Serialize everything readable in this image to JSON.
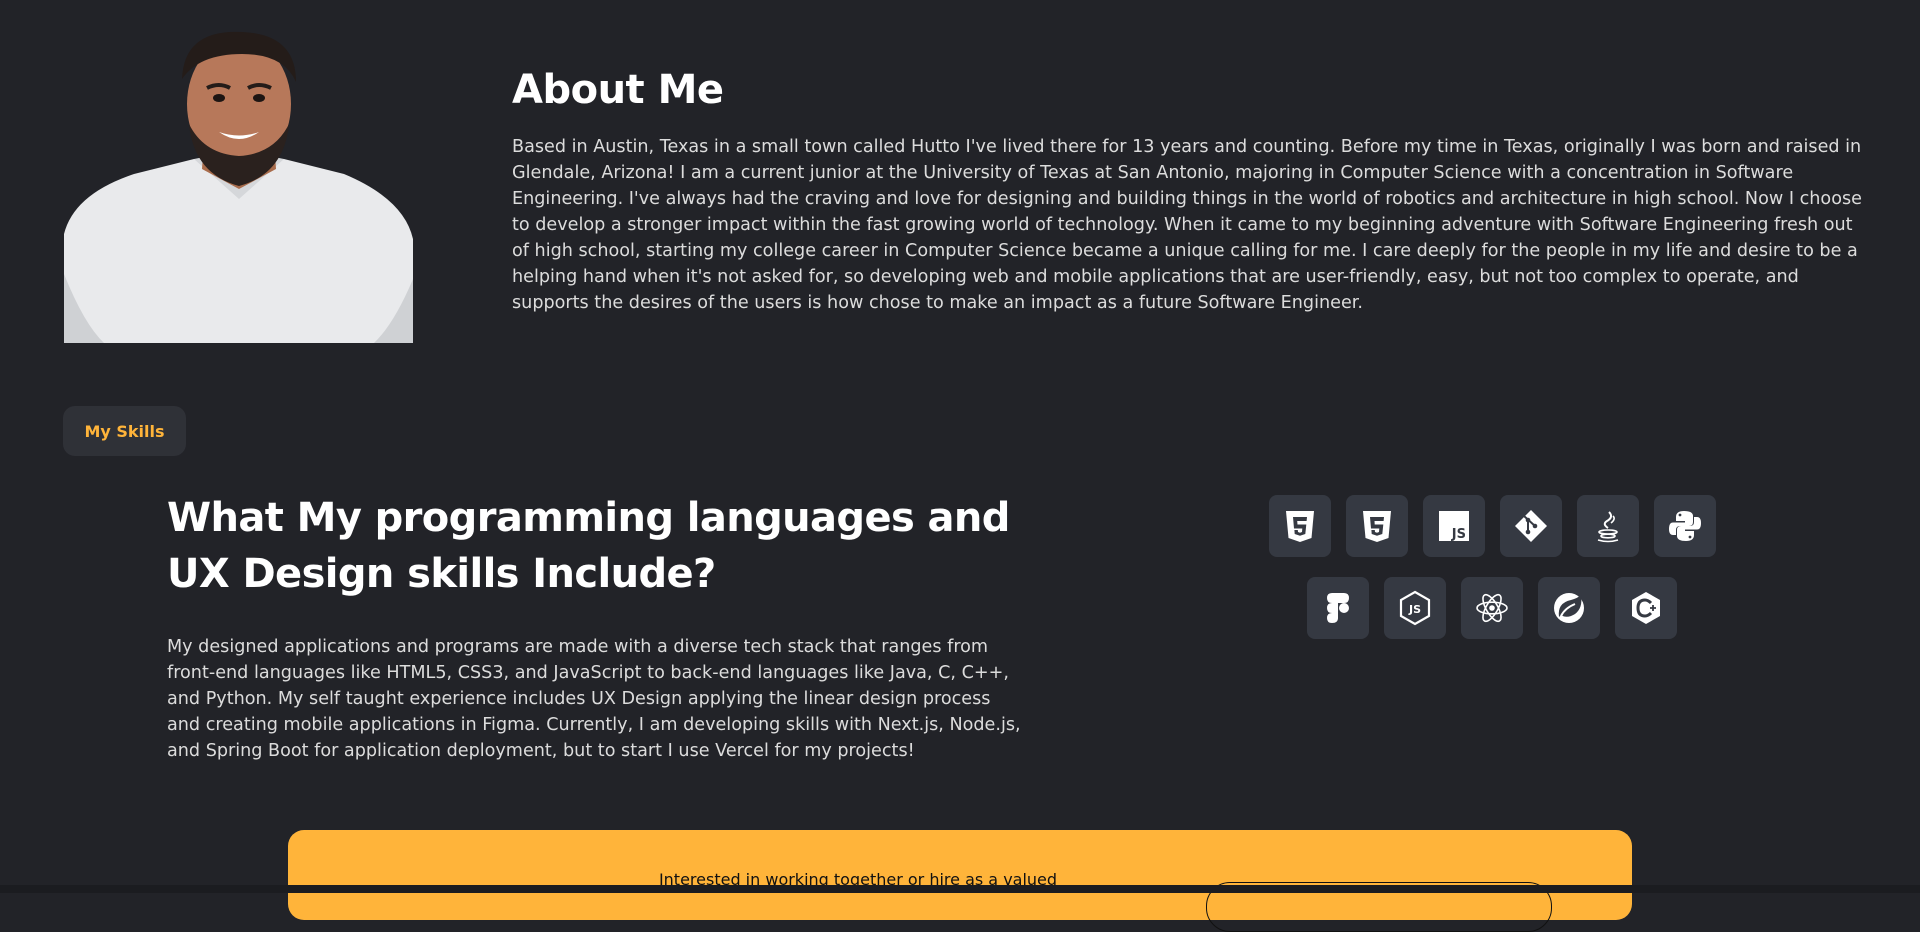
{
  "about": {
    "title": "About Me",
    "text": "Based in Austin, Texas in a small town called Hutto I've lived there for 13 years and counting. Before my time in Texas, originally I was born and raised in Glendale, Arizona! I am a current junior at the University of Texas at San Antonio, majoring in Computer Science with a concentration in Software Engineering. I've always had the craving and love for designing and building things in the world of robotics and architecture in high school. Now I choose to develop a stronger impact within the fast growing world of technology. When it came to my beginning adventure with Software Engineering fresh out of high school, starting my college career in Computer Science became a unique calling for me. I care deeply for the people in my life and desire to be a helping hand when it's not asked for, so developing web and mobile applications that are user-friendly, easy, but not too complex to operate, and supports the desires of the users is how chose to make an impact as a future Software Engineer."
  },
  "skills": {
    "pill_label": "My Skills",
    "heading": "What My programming languages and UX Design skills Include?",
    "text": "My designed applications and programs are made with a diverse tech stack that ranges from front-end languages like HTML5, CSS3, and JavaScript to back-end languages like Java, C, C++, and Python. My self taught experience includes UX Design applying the linear design process and creating mobile applications in Figma. Currently, I am developing skills with Next.js, Node.js, and Spring Boot for application deployment, but to start I use Vercel for my projects!",
    "icons_row1": [
      "html5-icon",
      "css3-icon",
      "javascript-icon",
      "git-icon",
      "java-icon",
      "python-icon"
    ],
    "icons_row2": [
      "figma-icon",
      "nodejs-icon",
      "react-icon",
      "spring-icon",
      "cplusplus-icon"
    ]
  },
  "cta": {
    "text": "Interested in working together or hire as a valued"
  },
  "colors": {
    "background": "#222328",
    "accent": "#ffb43a",
    "tile": "#353942"
  }
}
